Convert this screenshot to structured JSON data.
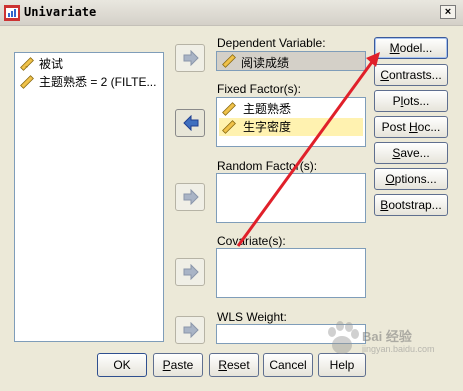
{
  "window": {
    "title": "Univariate",
    "close_label": "×"
  },
  "source_list": {
    "items": [
      {
        "label": "被试",
        "icon": "scale-ruler-icon"
      },
      {
        "label": "主题熟悉 = 2 (FILTE...",
        "icon": "scale-ruler-icon"
      }
    ]
  },
  "dependent_variable": {
    "label": "Dependent Variable:",
    "value": "阅读成绩",
    "icon": "scale-ruler-icon"
  },
  "fixed_factors": {
    "label": "Fixed Factor(s):",
    "items": [
      {
        "label": "主题熟悉",
        "selected": false
      },
      {
        "label": "生字密度",
        "selected": true
      }
    ]
  },
  "random_factors": {
    "label": "Random Factor(s):"
  },
  "covariates": {
    "label": "Covariate(s):"
  },
  "wls_weight": {
    "label": "WLS Weight:"
  },
  "side_buttons": [
    {
      "label": "Model...",
      "mnemonic": "M",
      "rest": "odel..."
    },
    {
      "label": "Contrasts...",
      "mnemonic": "C",
      "rest": "ontrasts..."
    },
    {
      "label": "Plots...",
      "mnemonic": "",
      "pre": "P",
      "mn": "l",
      "post": "ots..."
    },
    {
      "label": "Post Hoc...",
      "pre": "Post ",
      "mn": "H",
      "post": "oc..."
    },
    {
      "label": "Save...",
      "pre": "",
      "mn": "S",
      "post": "ave..."
    },
    {
      "label": "Options...",
      "pre": "",
      "mn": "O",
      "post": "ptions..."
    },
    {
      "label": "Bootstrap...",
      "pre": "",
      "mn": "B",
      "post": "ootstrap..."
    }
  ],
  "bottom_buttons": {
    "ok": "OK",
    "paste": {
      "mn": "P",
      "post": "aste"
    },
    "reset": {
      "mn": "R",
      "post": "eset"
    },
    "cancel": "Cancel",
    "help": "Help"
  },
  "watermark": {
    "brand": "Bai 经验",
    "sub": "jingyan.baidu.com"
  },
  "colors": {
    "dialog_bg": "#ece9d8",
    "selection": "#fff2b0",
    "annotation_arrow": "#e0202a",
    "field_border": "#7f9db9"
  }
}
